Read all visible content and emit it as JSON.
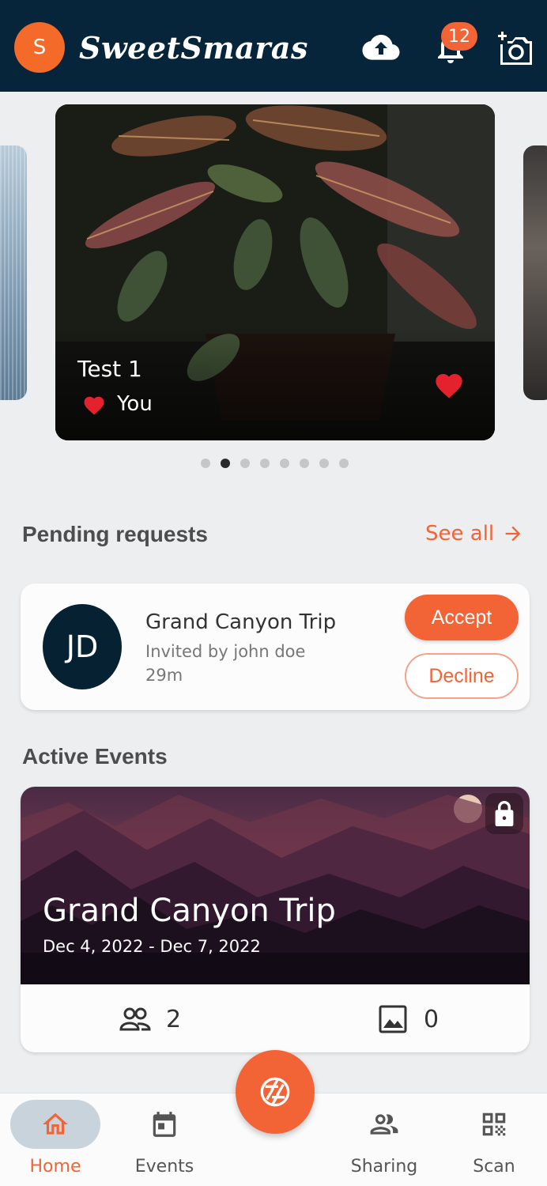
{
  "header": {
    "avatar_initial": "S",
    "brand": "SweetSmaras",
    "notification_count": "12"
  },
  "carousel": {
    "card_title": "Test 1",
    "card_owner": "You",
    "page_count": 8,
    "active_page": 1
  },
  "pending": {
    "title": "Pending requests",
    "see_all": "See all",
    "request": {
      "initials": "JD",
      "event_name": "Grand Canyon Trip",
      "invited_by": "Invited by john doe",
      "time": "29m",
      "accept_label": "Accept",
      "decline_label": "Decline"
    }
  },
  "active_events": {
    "title": "Active Events",
    "event": {
      "name": "Grand Canyon Trip",
      "dates": "Dec 4, 2022 - Dec 7, 2022",
      "members": "2",
      "photos": "0"
    }
  },
  "bottom_nav": {
    "home": "Home",
    "events": "Events",
    "sharing": "Sharing",
    "scan": "Scan"
  },
  "colors": {
    "header_bg": "#06253a",
    "accent": "#f26336",
    "avatar": "#f46a28"
  },
  "icons": [
    "cloud-upload-icon",
    "bell-icon",
    "add-photo-icon",
    "heart-icon",
    "arrow-right-icon",
    "lock-icon",
    "people-icon",
    "image-icon",
    "home-icon",
    "calendar-icon",
    "group-icon",
    "qr-code-icon",
    "camera-shutter-icon"
  ]
}
